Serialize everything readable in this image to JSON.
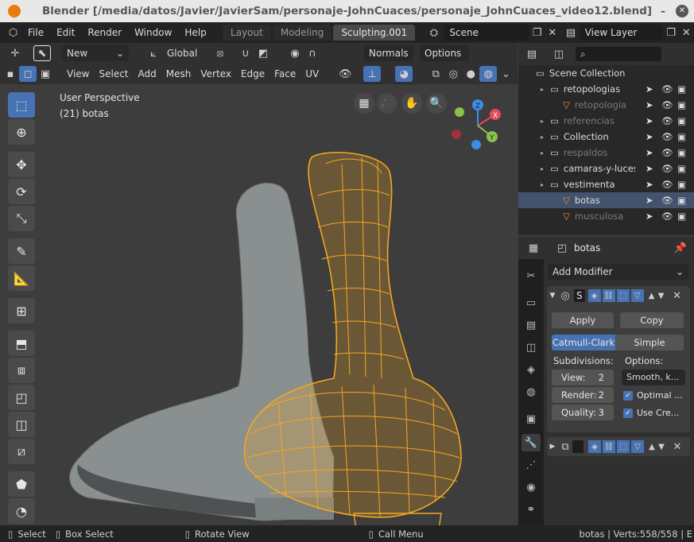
{
  "window": {
    "title": "Blender [/media/datos/Javier/JavierSam/personaje-JohnCuaces/personaje_JohnCuaces_video12.blend]",
    "close": "✕",
    "min": "–"
  },
  "menubar": {
    "items": [
      "File",
      "Edit",
      "Render",
      "Window",
      "Help"
    ],
    "workspaces": [
      "Layout",
      "Modeling",
      "Sculpting.001"
    ],
    "scene": "Scene",
    "view_layer": "View Layer"
  },
  "viewport": {
    "header1": {
      "new": "New",
      "orientation": "Global",
      "normals": "Normals",
      "options": "Options"
    },
    "header2": {
      "menus": [
        "View",
        "Select",
        "Add",
        "Mesh",
        "Vertex",
        "Edge",
        "Face",
        "UV"
      ]
    },
    "info_line1": "User Perspective",
    "info_line2": "(21) botas",
    "gizmo": {
      "x": "X",
      "y": "Y",
      "z": "Z"
    }
  },
  "outliner": {
    "root": "Scene Collection",
    "rows": [
      {
        "label": "retopologias",
        "indent": 1,
        "dim": false,
        "sel": false
      },
      {
        "label": "retopologia",
        "indent": 2,
        "dim": true,
        "sel": false
      },
      {
        "label": "referencias",
        "indent": 1,
        "dim": true,
        "sel": false
      },
      {
        "label": "Collection",
        "indent": 1,
        "dim": false,
        "sel": false
      },
      {
        "label": "respaldos",
        "indent": 1,
        "dim": true,
        "sel": false
      },
      {
        "label": "camaras-y-luces",
        "indent": 1,
        "dim": false,
        "sel": false
      },
      {
        "label": "vestimenta",
        "indent": 1,
        "dim": false,
        "sel": false
      },
      {
        "label": "botas",
        "indent": 2,
        "dim": false,
        "sel": true
      },
      {
        "label": "musculosa",
        "indent": 2,
        "dim": true,
        "sel": false
      }
    ]
  },
  "properties": {
    "object": "botas",
    "add_modifier": "Add Modifier",
    "modifier_name": "S",
    "apply": "Apply",
    "copy": "Copy",
    "algo_catmull": "Catmull-Clark",
    "algo_simple": "Simple",
    "subdivisions_label": "Subdivisions:",
    "options_label": "Options:",
    "view": "View:",
    "view_val": "2",
    "render": "Render:",
    "render_val": "2",
    "quality": "Quality:",
    "quality_val": "3",
    "smooth": "Smooth, k...",
    "optimal": "Optimal ...",
    "use_cre": "Use Cre..."
  },
  "statusbar": {
    "select": "Select",
    "box_select": "Box Select",
    "rotate": "Rotate View",
    "call_menu": "Call Menu",
    "stats": "botas | Verts:558/558 | E"
  },
  "colors": {
    "accent": "#4772b3",
    "selected_orange": "#f5a623",
    "axis_x": "#e54a5b",
    "axis_y": "#8ac24a",
    "axis_z": "#3a8ee6"
  }
}
